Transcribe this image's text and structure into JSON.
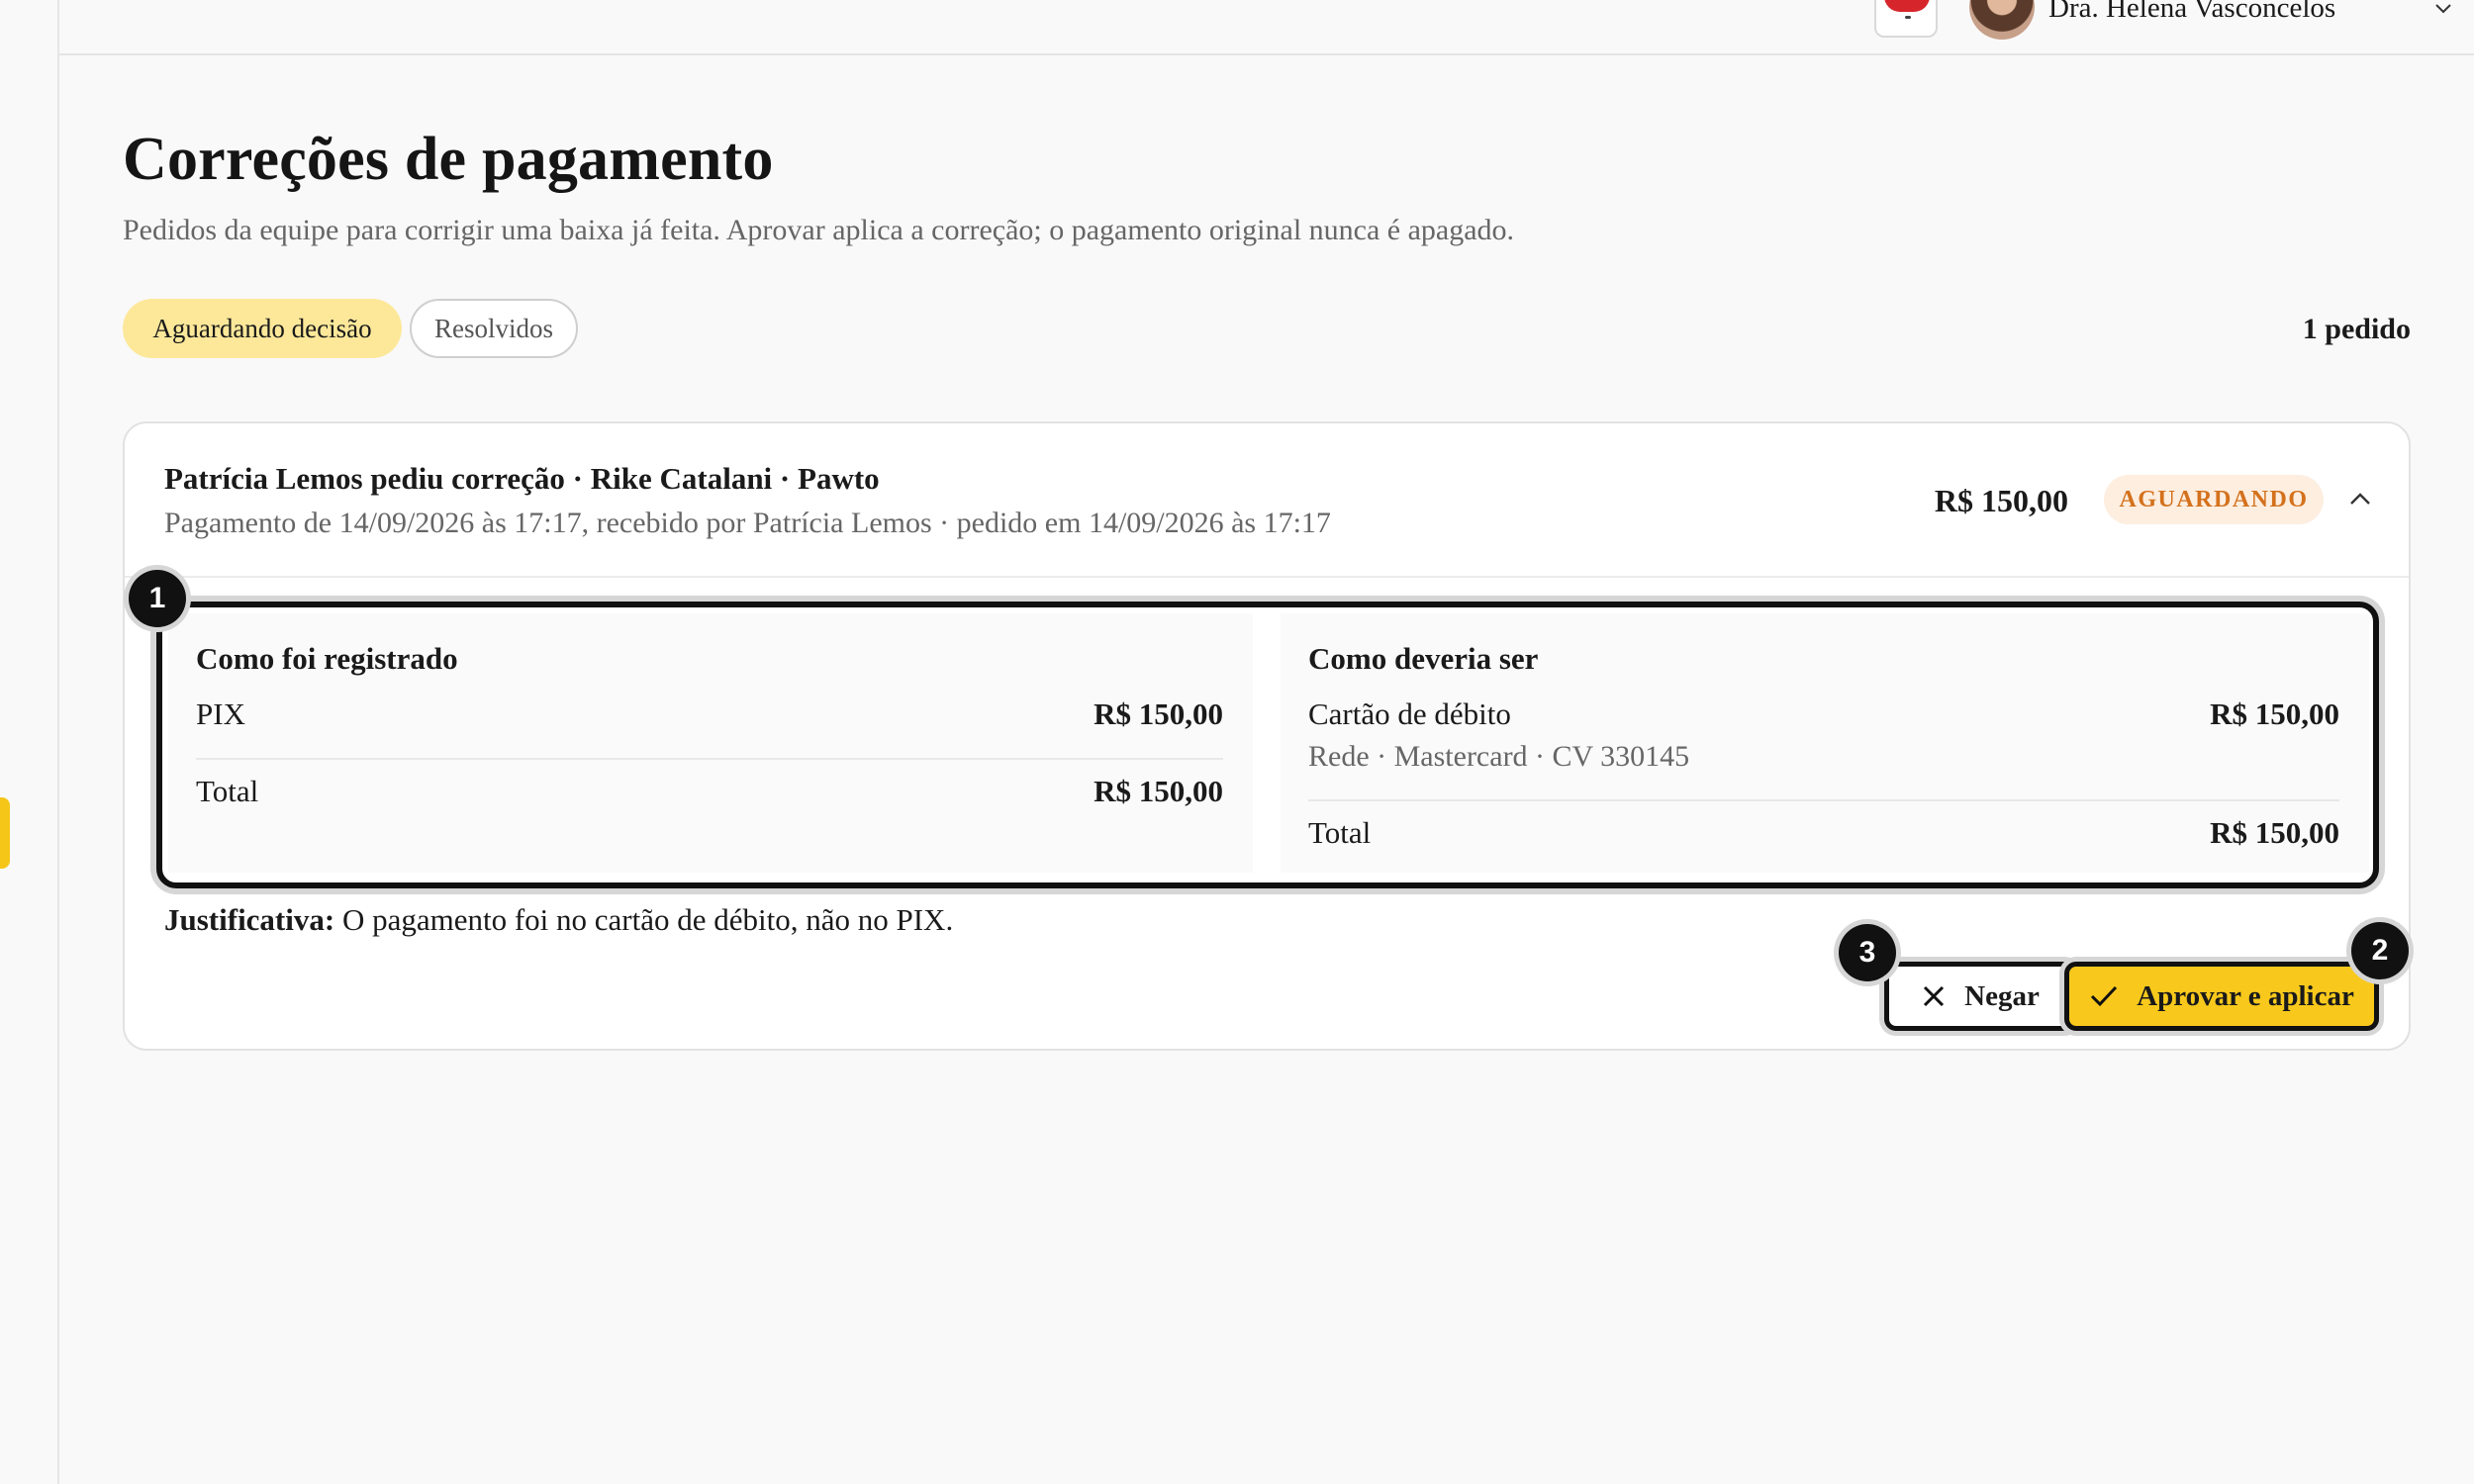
{
  "topbar": {
    "user_name": "Dra. Helena Vasconcelos"
  },
  "page": {
    "title": "Correções de pagamento",
    "subtitle": "Pedidos da equipe para corrigir uma baixa já feita. Aprovar aplica a correção; o pagamento original nunca é apagado."
  },
  "tabs": [
    {
      "label": "Aguardando decisão",
      "active": true
    },
    {
      "label": "Resolvidos",
      "active": false
    }
  ],
  "count_label": "1 pedido",
  "request": {
    "title": "Patrícia Lemos pediu correção · Rike Catalani · Pawto",
    "subtitle": "Pagamento de 14/09/2026 às 17:17, recebido por Patrícia Lemos · pedido em 14/09/2026 às 17:17",
    "amount": "R$ 150,00",
    "status": "AGUARDANDO",
    "registered": {
      "title": "Como foi registrado",
      "method": "PIX",
      "method_value": "R$ 150,00",
      "total_label": "Total",
      "total_value": "R$ 150,00"
    },
    "expected": {
      "title": "Como deveria ser",
      "method": "Cartão de débito",
      "method_value": "R$ 150,00",
      "detail": "Rede · Mastercard · CV 330145",
      "total_label": "Total",
      "total_value": "R$ 150,00"
    },
    "justification_label": "Justificativa:",
    "justification_text": " O pagamento foi no cartão de débito, não no PIX."
  },
  "actions": {
    "deny_label": "Negar",
    "approve_label": "Aprovar e aplicar"
  },
  "markers": {
    "one": "1",
    "two": "2",
    "three": "3"
  },
  "colors": {
    "accent": "#f8c91c",
    "tab_active_bg": "#fde89a",
    "status_bg": "#fdeee0",
    "status_text": "#d4711c",
    "notification": "#d6262c"
  }
}
